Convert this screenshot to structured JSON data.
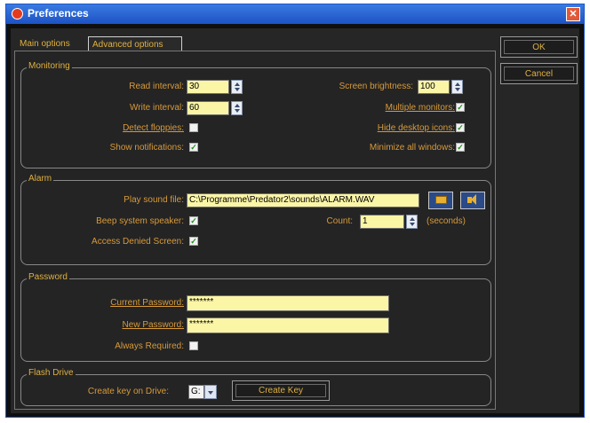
{
  "window": {
    "title": "Preferences"
  },
  "tabs": [
    {
      "label": "Main options"
    },
    {
      "label": "Advanced options"
    }
  ],
  "buttons": {
    "ok": "OK",
    "cancel": "Cancel"
  },
  "monitoring": {
    "legend": "Monitoring",
    "read_interval_label": "Read interval:",
    "read_interval_value": "30",
    "write_interval_label": "Write interval:",
    "write_interval_value": "60",
    "detect_floppies_label": "Detect floppies:",
    "detect_floppies_checked": false,
    "show_notifications_label": "Show notifications:",
    "show_notifications_checked": true,
    "screen_brightness_label": "Screen brightness:",
    "screen_brightness_value": "100",
    "multiple_monitors_label": "Multiple monitors:",
    "multiple_monitors_checked": true,
    "hide_desktop_icons_label": "Hide desktop icons:",
    "hide_desktop_icons_checked": true,
    "minimize_all_windows_label": "Minimize all windows:",
    "minimize_all_windows_checked": true
  },
  "alarm": {
    "legend": "Alarm",
    "play_sound_label": "Play sound file:",
    "play_sound_value": "C:\\Programme\\Predator2\\sounds\\ALARM.WAV",
    "beep_label": "Beep system speaker:",
    "beep_checked": true,
    "access_denied_label": "Access Denied Screen:",
    "access_denied_checked": true,
    "count_label": "Count:",
    "count_value": "1",
    "count_unit": "(seconds)"
  },
  "password": {
    "legend": "Password",
    "current_label": "Current Password:",
    "current_value": "*******",
    "new_label": "New Password:",
    "new_value": "*******",
    "always_required_label": "Always Required:",
    "always_required_checked": false
  },
  "flash": {
    "legend": "Flash Drive",
    "create_key_label": "Create key on Drive:",
    "drive_value": "G:",
    "create_key_button": "Create Key"
  },
  "colors": {
    "accent": "#e0b040",
    "label": "#d89a3a",
    "input_bg": "#fbf5a6",
    "titlebar": "#1c52c6"
  }
}
